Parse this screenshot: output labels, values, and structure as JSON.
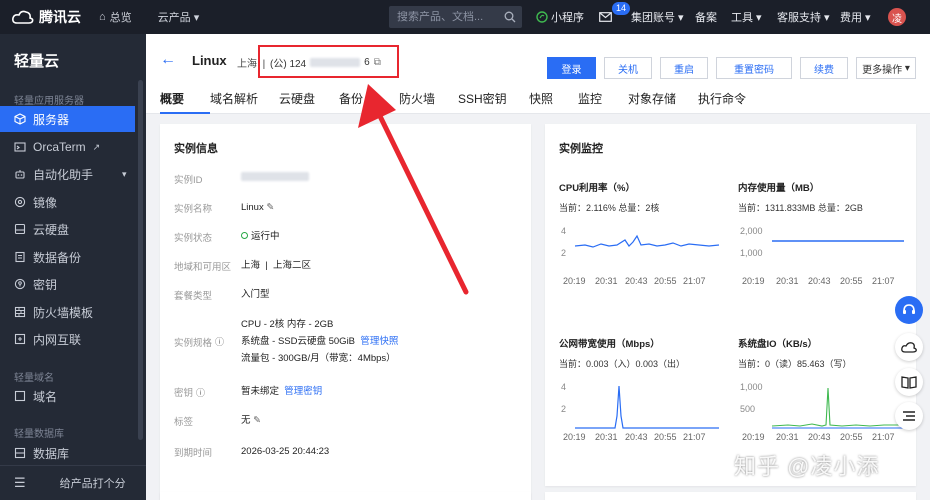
{
  "topbar": {
    "brand": "腾讯云",
    "overview": "总览",
    "cloud_products": "云产品",
    "search_placeholder": "搜索产品、文档...",
    "mini_program": "小程序",
    "message_count": "14",
    "group_account": "集团账号",
    "filing": "备案",
    "tools": "工具",
    "support": "客服支持",
    "billing": "费用",
    "avatar": "凌"
  },
  "sidebar": {
    "title": "轻量云",
    "groups": [
      "轻量应用服务器",
      "轻量域名",
      "轻量数据库"
    ],
    "items": [
      {
        "label": "服务器",
        "icon": "cube-icon"
      },
      {
        "label": "OrcaTerm",
        "icon": "terminal-icon"
      },
      {
        "label": "自动化助手",
        "icon": "robot-icon"
      },
      {
        "label": "镜像",
        "icon": "image-icon"
      },
      {
        "label": "云硬盘",
        "icon": "disk-icon"
      },
      {
        "label": "数据备份",
        "icon": "backup-icon"
      },
      {
        "label": "密钥",
        "icon": "key-icon"
      },
      {
        "label": "防火墙模板",
        "icon": "firewall-icon"
      },
      {
        "label": "内网互联",
        "icon": "network-icon"
      },
      {
        "label": "域名",
        "icon": "domain-icon"
      },
      {
        "label": "数据库",
        "icon": "database-icon"
      }
    ],
    "footer": "给产品打个分"
  },
  "header": {
    "title": "Linux",
    "region": "上海",
    "separator": "|",
    "ip_prefix": "(公) 124",
    "ip_suffix": "6",
    "buttons": [
      "登录",
      "关机",
      "重启",
      "重置密码",
      "续费"
    ],
    "more": "更多操作",
    "tabs": [
      "概要",
      "域名解析",
      "云硬盘",
      "备份",
      "防火墙",
      "SSH密钥",
      "快照",
      "监控",
      "对象存储",
      "执行命令"
    ]
  },
  "instance": {
    "title": "实例信息",
    "rows": [
      {
        "key": "实例ID",
        "value": ""
      },
      {
        "key": "实例名称",
        "value": "Linux"
      },
      {
        "key": "实例状态",
        "value": "运行中"
      },
      {
        "key": "地域和可用区",
        "value": "上海  |  上海二区"
      },
      {
        "key": "套餐类型",
        "value": "入门型"
      },
      {
        "key": "实例规格",
        "value": "CPU - 2核 内存 - 2GB"
      },
      {
        "key": "密钥",
        "value": "暂未绑定"
      },
      {
        "key": "标签",
        "value": "无"
      },
      {
        "key": "到期时间",
        "value": "2026-03-25 20:44:23"
      }
    ],
    "spec_disk": "系统盘 - SSD云硬盘 50GiB",
    "spec_disk_link": "管理快照",
    "spec_traffic": "流量包 - 300GB/月（带宽：4Mbps）",
    "key_link": "管理密钥"
  },
  "monitor": {
    "title": "实例监控",
    "colors": {
      "line": "#2a6df4",
      "line2": "#3fb950"
    },
    "charts": [
      {
        "title": "CPU利用率（%）",
        "value": "当前：2.116% 总量：2核",
        "yticks": [
          "4",
          "2"
        ],
        "xticks": [
          "20:19",
          "20:31",
          "20:43",
          "20:55",
          "21:07"
        ]
      },
      {
        "title": "内存使用量（MB）",
        "value": "当前：1311.833MB 总量：2GB",
        "yticks": [
          "2,000",
          "1,000"
        ],
        "xticks": [
          "20:19",
          "20:31",
          "20:43",
          "20:55",
          "21:07"
        ]
      },
      {
        "title": "公网带宽使用（Mbps）",
        "value": "当前：0.003（入）0.003（出）",
        "yticks": [
          "4",
          "2"
        ],
        "xticks": [
          "20:19",
          "20:31",
          "20:43",
          "20:55",
          "21:07"
        ]
      },
      {
        "title": "系统盘IO（KB/s）",
        "value": "当前：0（读）85.463（写）",
        "yticks": [
          "1,000",
          "500"
        ],
        "xticks": [
          "20:19",
          "20:31",
          "20:43",
          "20:55",
          "21:07"
        ]
      }
    ]
  },
  "watermark": "知乎 @凌小添",
  "accent": "#2a6df4",
  "annotation_color": "#e8262f"
}
